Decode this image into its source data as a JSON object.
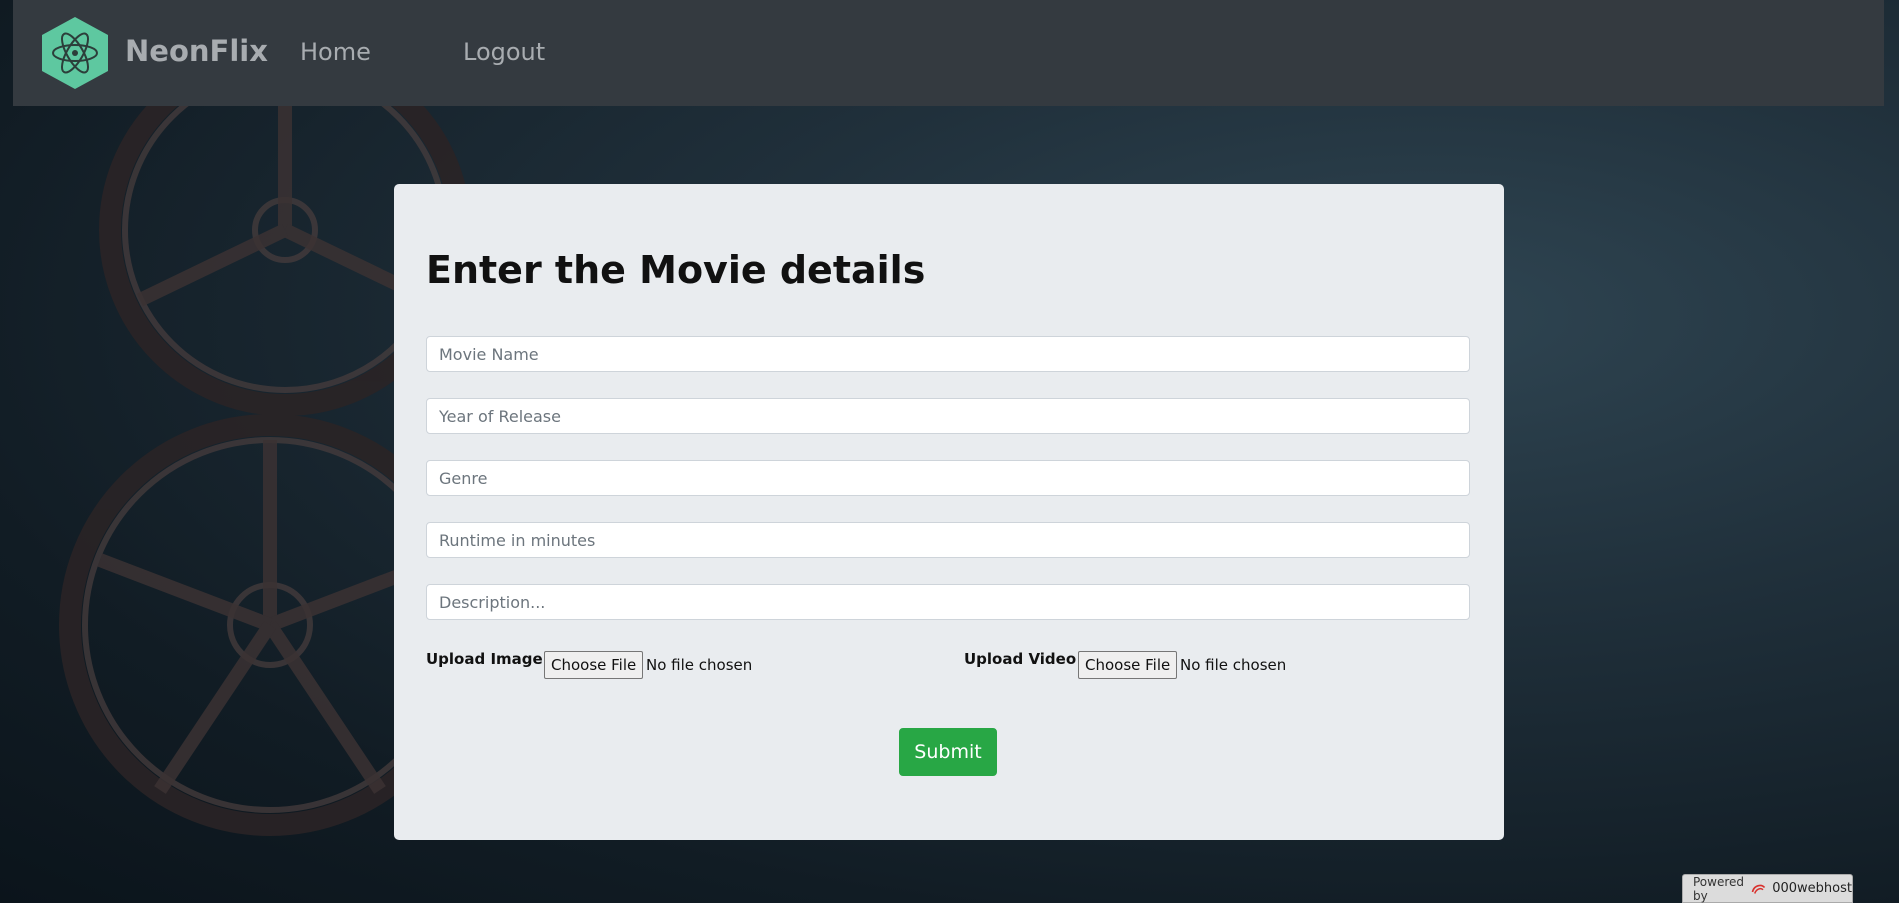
{
  "header": {
    "brand": "NeonFlix",
    "nav": [
      {
        "label": "Home"
      },
      {
        "label": "Logout"
      }
    ]
  },
  "form": {
    "title": "Enter the Movie details",
    "fields": [
      {
        "placeholder": "Movie Name"
      },
      {
        "placeholder": "Year of Release"
      },
      {
        "placeholder": "Genre"
      },
      {
        "placeholder": "Runtime in minutes"
      },
      {
        "placeholder": "Description..."
      }
    ],
    "upload_image": {
      "label": "Upload Image :",
      "button": "Choose File",
      "status": "No file chosen"
    },
    "upload_video": {
      "label": "Upload Video :",
      "button": "Choose File",
      "status": "No file chosen"
    },
    "submit_label": "Submit"
  },
  "badge": {
    "prefix": "Powered by",
    "host": "000webhost"
  },
  "colors": {
    "navbar": "#343a40",
    "logo": "#5ec8a0",
    "submit": "#28a745",
    "card": "#e9ecef"
  }
}
